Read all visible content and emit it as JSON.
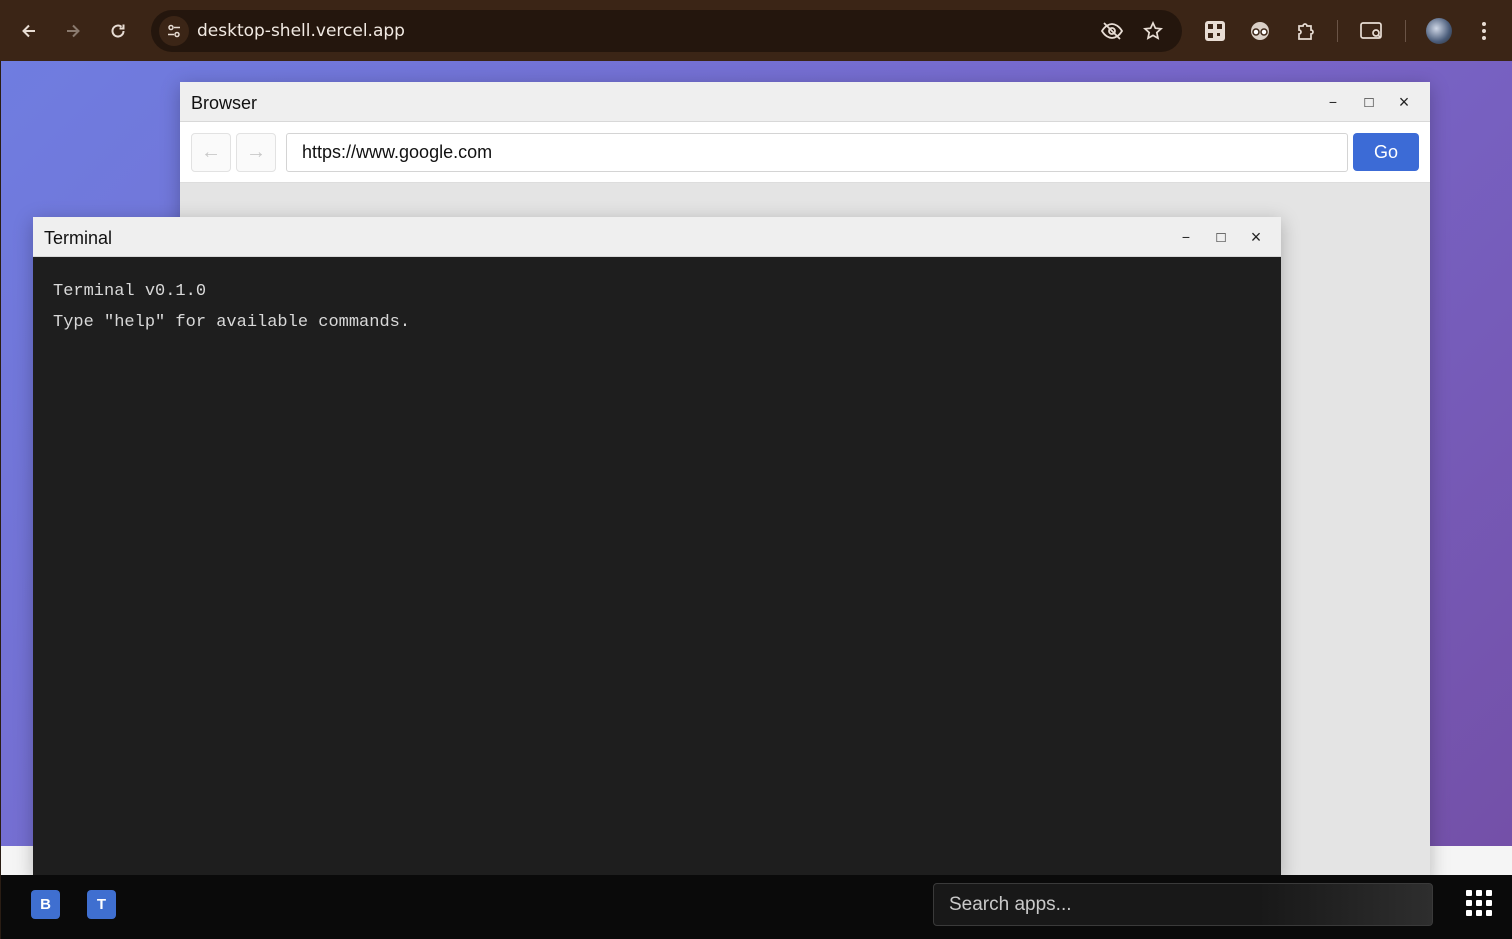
{
  "chrome": {
    "url": "desktop-shell.vercel.app",
    "back_icon": "arrow-left-icon",
    "forward_icon": "arrow-right-icon",
    "reload_icon": "reload-icon"
  },
  "browser_window": {
    "title": "Browser",
    "minimize": "−",
    "maximize": "□",
    "close": "×",
    "back": "←",
    "forward": "→",
    "url_value": "https://www.google.com",
    "go_label": "Go"
  },
  "terminal_window": {
    "title": "Terminal",
    "minimize": "−",
    "maximize": "□",
    "close": "×",
    "lines": [
      "Terminal v0.1.0",
      "Type \"help\" for available commands."
    ]
  },
  "taskbar": {
    "apps": [
      {
        "letter": "B",
        "name": "Browser"
      },
      {
        "letter": "T",
        "name": "Terminal"
      }
    ],
    "search_placeholder": "Search apps...",
    "accent": "#3f6fd0"
  }
}
